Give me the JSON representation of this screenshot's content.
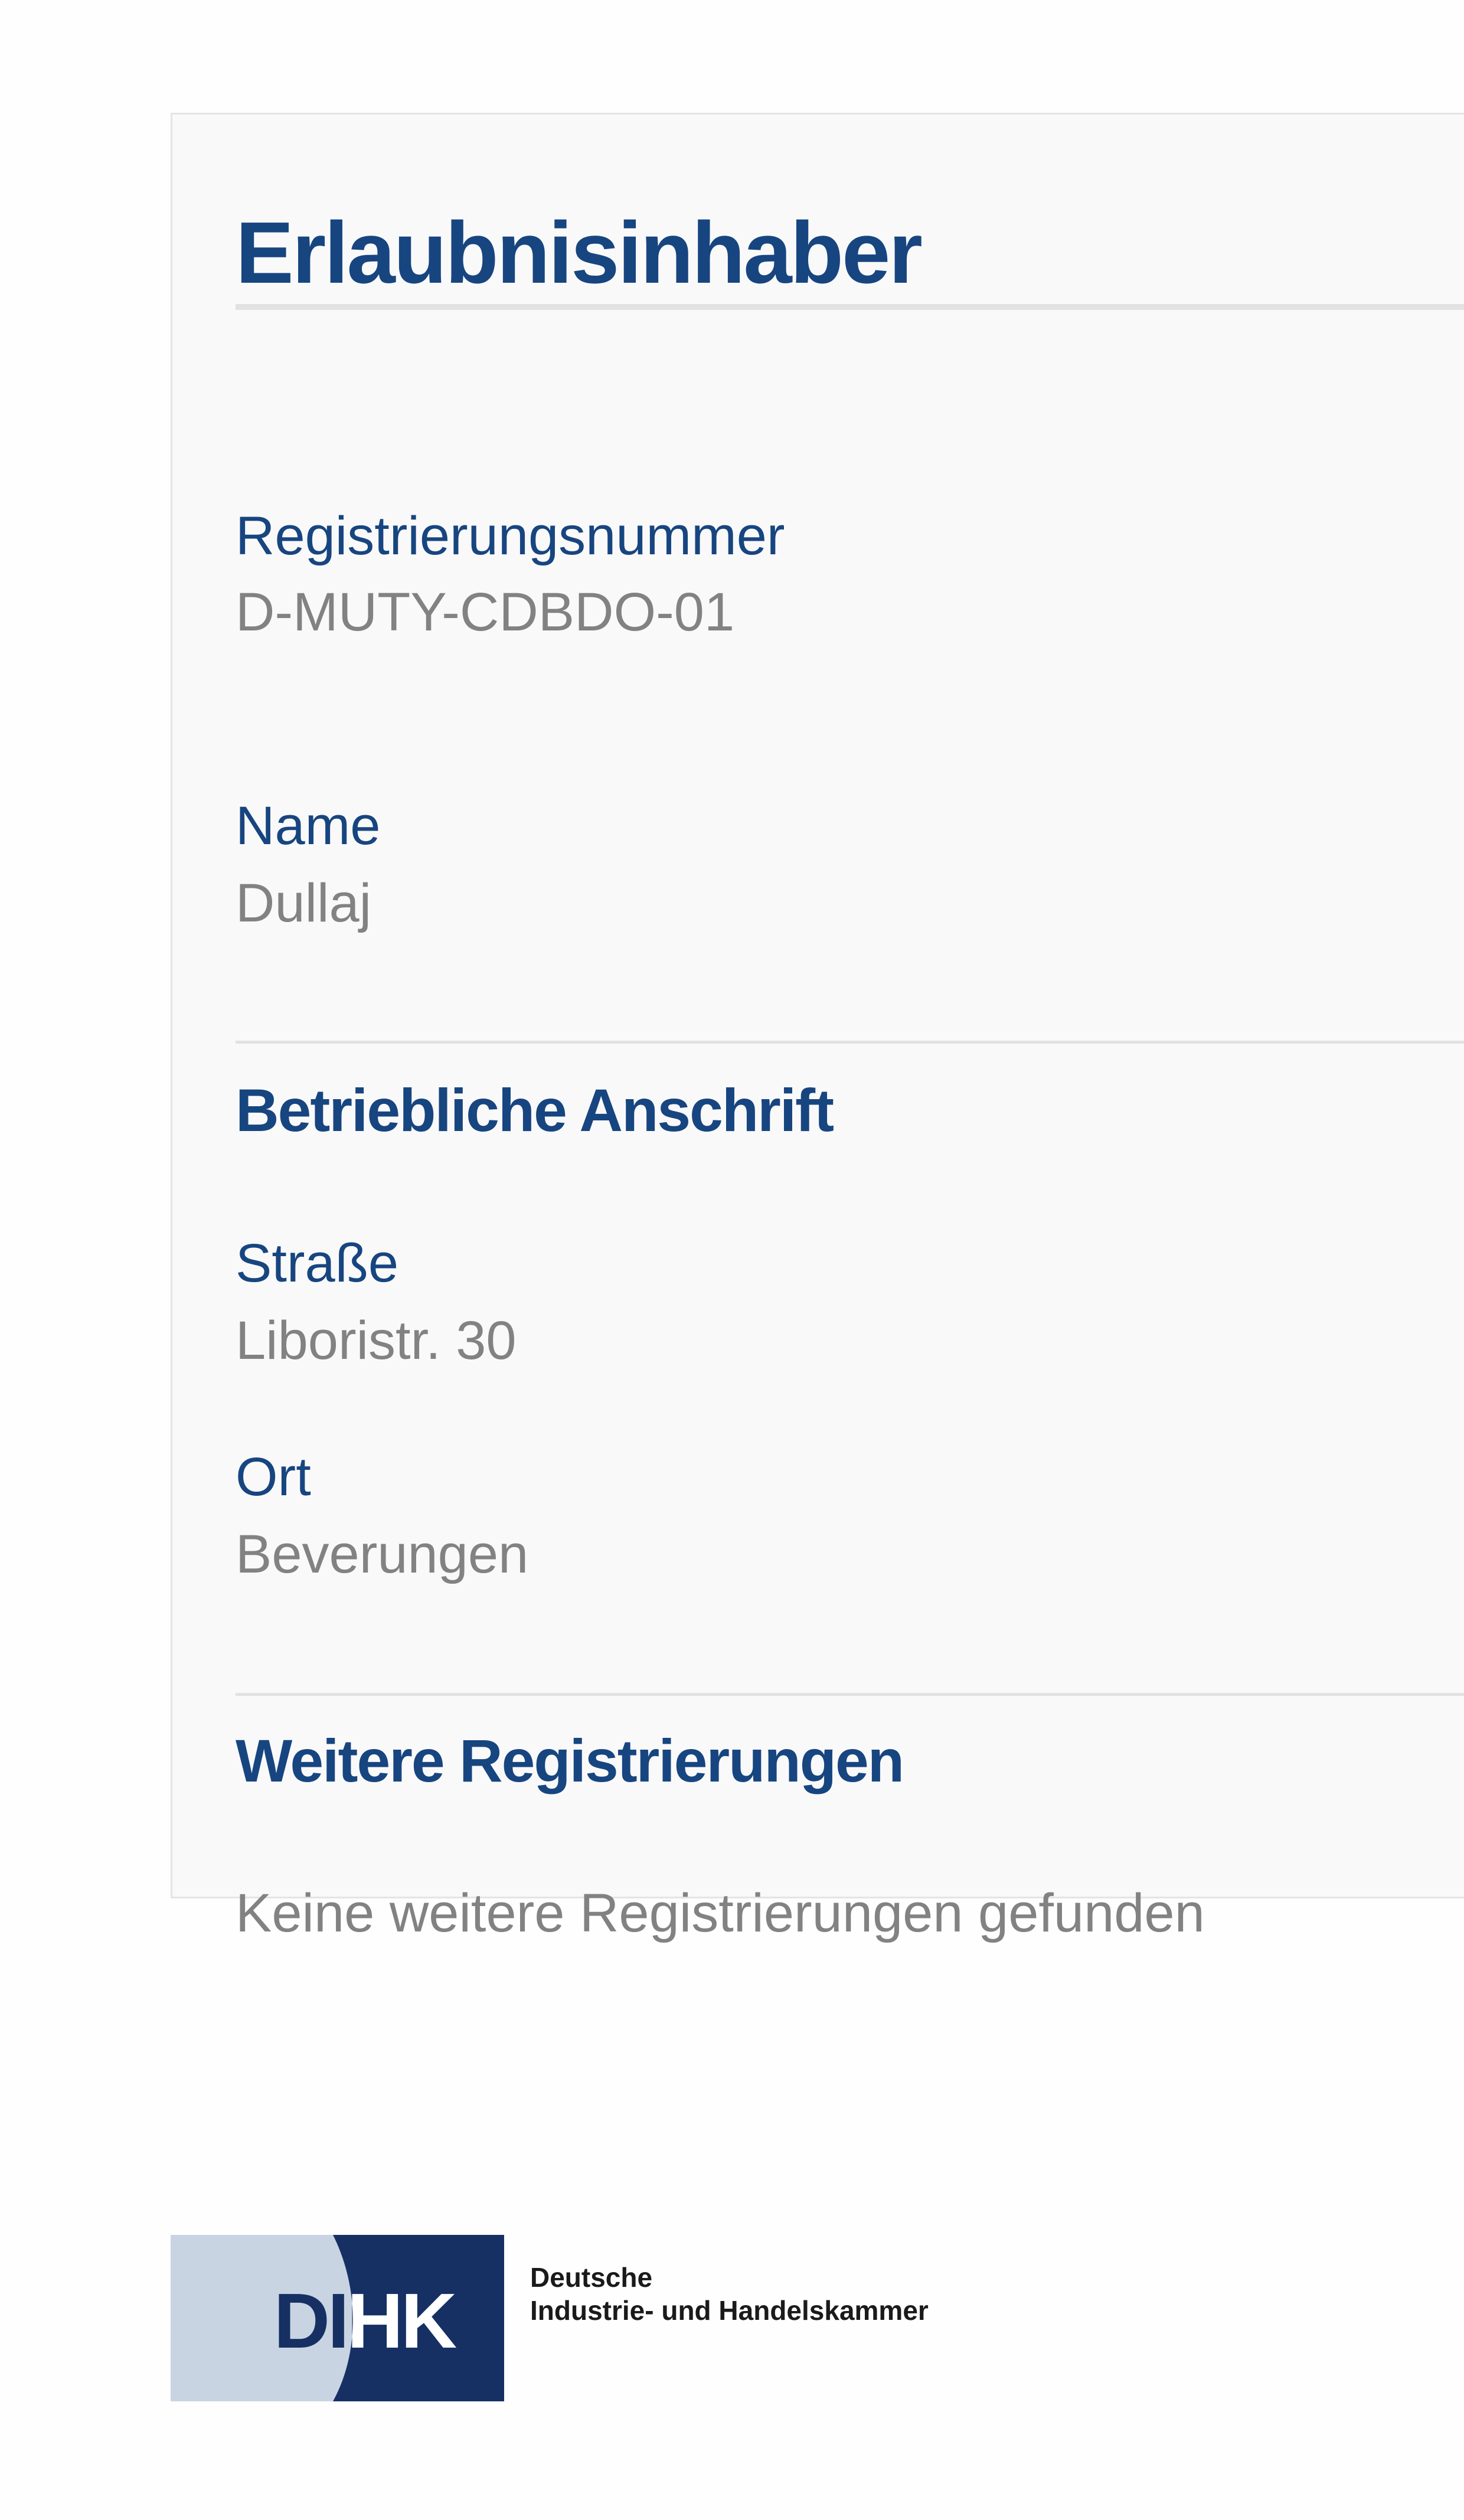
{
  "permit_holder": {
    "title": "Erlaubnisinhaber",
    "registration_number": {
      "label": "Registrierungsnummer",
      "value": "D-MUTY-CDBDO-01"
    },
    "name": {
      "label": "Name",
      "value": "Dullaj"
    }
  },
  "business_address": {
    "title": "Betriebliche Anschrift",
    "street": {
      "label": "Straße",
      "value": "Liboristr. 30"
    },
    "city": {
      "label": "Ort",
      "value": "Beverungen"
    }
  },
  "further_registrations": {
    "title": "Weitere Registrierungen",
    "empty_message": "Keine weitere Registrierungen gefunden"
  },
  "footer": {
    "logo": {
      "mark": "DIHK",
      "line1": "Deutsche",
      "line2": "Industrie- und Handelskammer"
    },
    "colors": {
      "brand_blue": "#174580",
      "logo_dark": "#163064",
      "logo_light": "#c9d4e3"
    }
  }
}
